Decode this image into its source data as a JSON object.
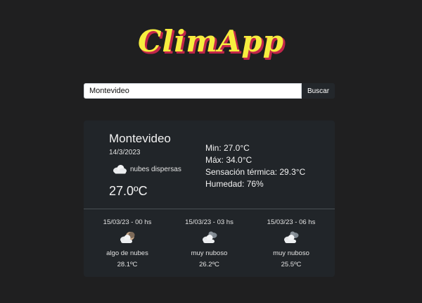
{
  "app": {
    "logo_text": "ClimApp"
  },
  "search": {
    "value": "Montevideo",
    "button_label": "Buscar"
  },
  "current": {
    "city": "Montevideo",
    "date": "14/3/2023",
    "condition_icon": "scattered-clouds-icon",
    "condition": "nubes dispersas",
    "temperature": "27.0ºC",
    "min": "Min: 27.0°C",
    "max": "Máx: 34.0°C",
    "feels_like": "Sensación térmica: 29.3°C",
    "humidity": "Humedad: 76%"
  },
  "forecast": [
    {
      "time": "15/03/23 - 00 hs",
      "icon": "few-clouds-night-icon",
      "description": "algo de nubes",
      "temp": "28.1ºC"
    },
    {
      "time": "15/03/23 - 03 hs",
      "icon": "broken-clouds-icon",
      "description": "muy nuboso",
      "temp": "26.2ºC"
    },
    {
      "time": "15/03/23 - 06 hs",
      "icon": "broken-clouds-icon",
      "description": "muy nuboso",
      "temp": "25.5ºC"
    }
  ],
  "colors": {
    "background": "#1f1f20",
    "card": "#212529",
    "logo_fill": "#f6ee3f",
    "logo_shadow": "#c2264a",
    "button": "#23272b"
  }
}
